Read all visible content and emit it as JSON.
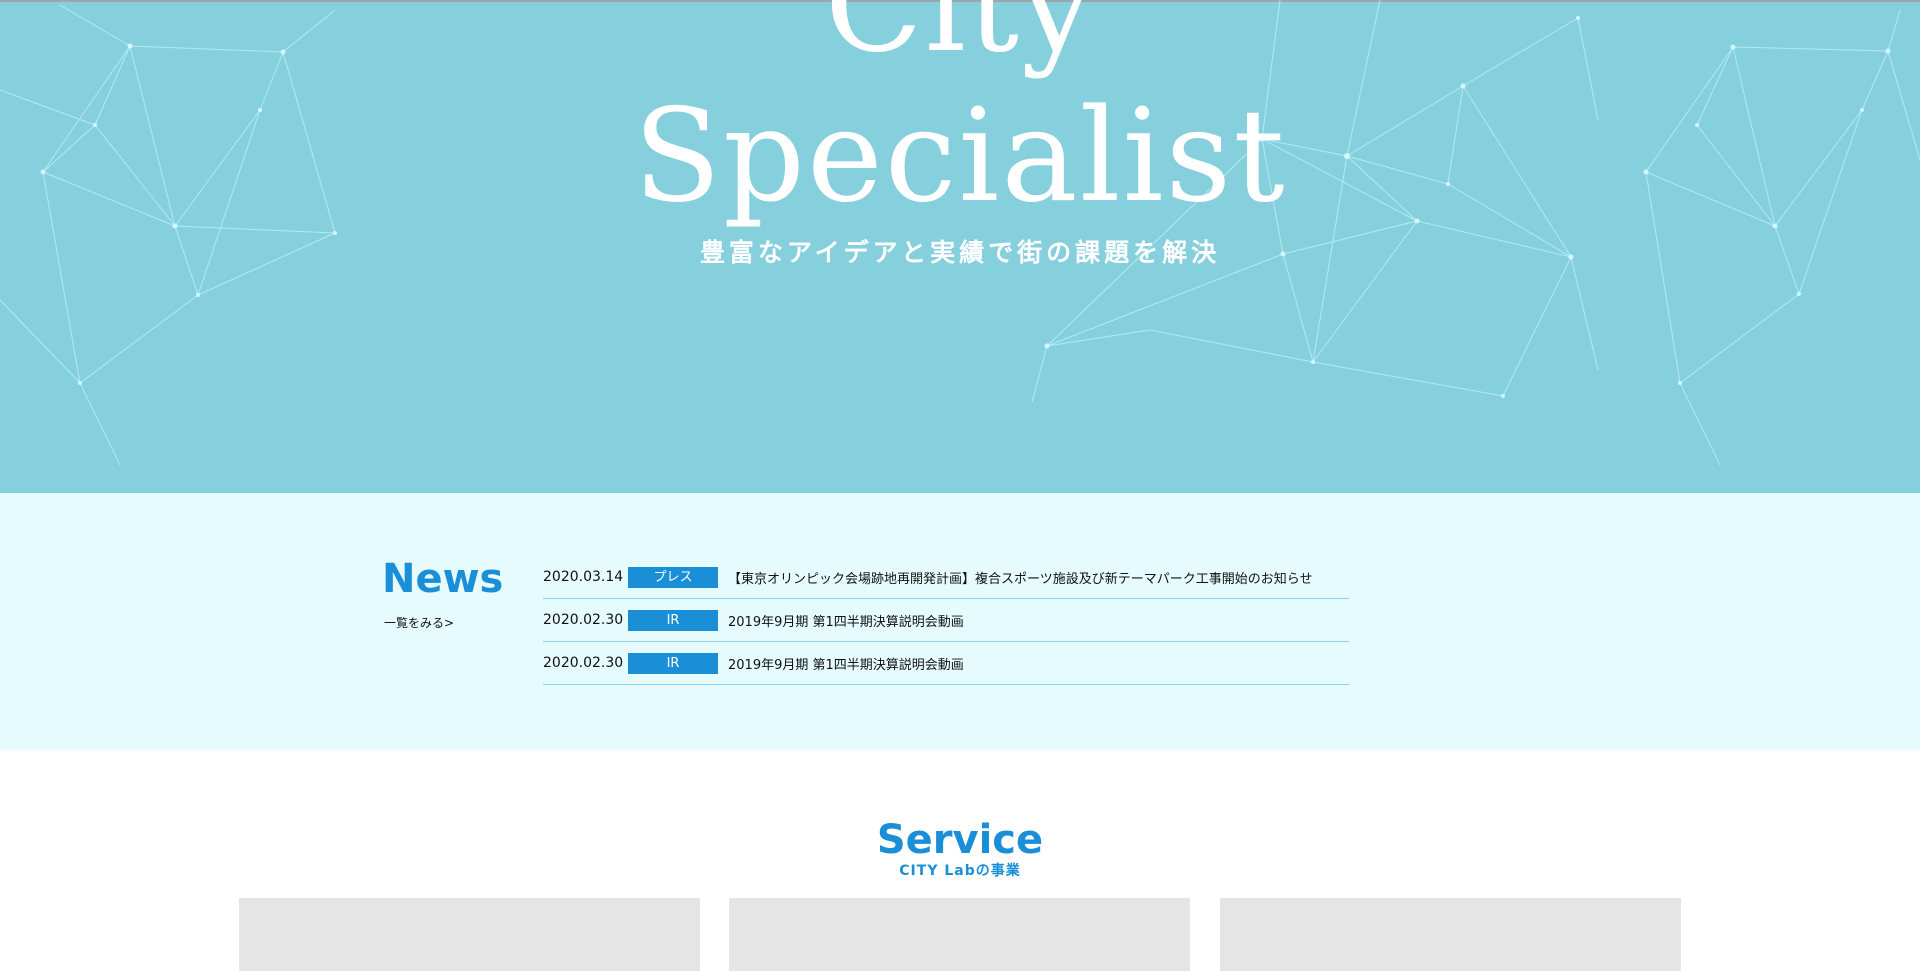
{
  "hero": {
    "title_line1": "City",
    "title_line2": "Specialist",
    "subtitle": "豊富なアイデアと実績で街の課題を解決"
  },
  "news": {
    "heading": "News",
    "more_link": "一覧をみる>",
    "items": [
      {
        "date": "2020.03.14",
        "tag": "プレス",
        "title": "【東京オリンピック会場跡地再開発計画】複合スポーツ施設及び新テーマパーク工事開始のお知らせ"
      },
      {
        "date": "2020.02.30",
        "tag": "IR",
        "title": "2019年9月期 第1四半期決算説明会動画"
      },
      {
        "date": "2020.02.30",
        "tag": "IR",
        "title": "2019年9月期 第1四半期決算説明会動画"
      }
    ]
  },
  "service": {
    "heading": "Service",
    "subheading": "CITY Labの事業"
  },
  "colors": {
    "hero_bg": "#86d0dd",
    "news_bg": "#e6fbfd",
    "accent_blue": "#1a8fd7",
    "card_gray": "#e5e5e5"
  }
}
